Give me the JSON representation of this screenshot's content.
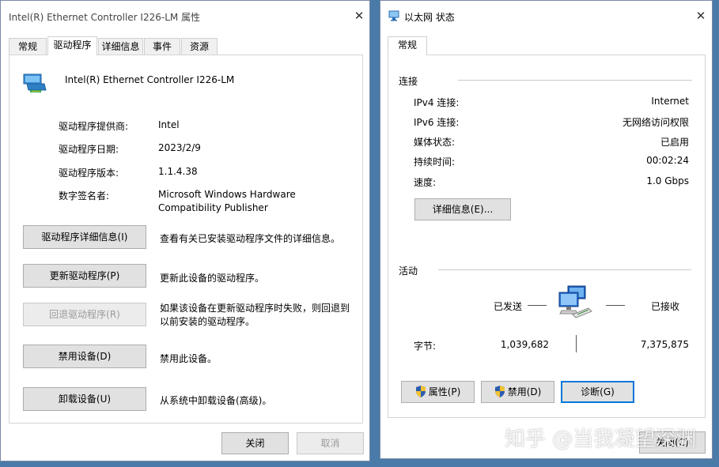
{
  "left_window": {
    "title": "Intel(R) Ethernet Controller I226-LM 属性",
    "close_glyph": "✕",
    "tabs": [
      "常规",
      "驱动程序",
      "详细信息",
      "事件",
      "资源"
    ],
    "device_name": "Intel(R) Ethernet Controller I226-LM",
    "fields": [
      {
        "label": "驱动程序提供商:",
        "value": "Intel"
      },
      {
        "label": "驱动程序日期:",
        "value": "2023/2/9"
      },
      {
        "label": "驱动程序版本:",
        "value": "1.1.4.38"
      },
      {
        "label": "数字签名者:",
        "value": "Microsoft Windows Hardware Compatibility Publisher"
      }
    ],
    "actions": [
      {
        "button": "驱动程序详细信息(I)",
        "description": "查看有关已安装驱动程序文件的详细信息。"
      },
      {
        "button": "更新驱动程序(P)",
        "description": "更新此设备的驱动程序。"
      },
      {
        "button": "回退驱动程序(R)",
        "description": "如果该设备在更新驱动程序时失败，则回退到以前安装的驱动程序。"
      },
      {
        "button": "禁用设备(D)",
        "description": "禁用此设备。"
      },
      {
        "button": "卸载设备(U)",
        "description": "从系统中卸载设备(高级)。"
      }
    ],
    "ok_label": "关闭",
    "cancel_label": "取消"
  },
  "right_window": {
    "title": "以太网 状态",
    "close_glyph": "✕",
    "tab": "常规",
    "connection": {
      "heading": "连接",
      "rows": [
        {
          "label": "IPv4 连接:",
          "value": "Internet"
        },
        {
          "label": "IPv6 连接:",
          "value": "无网络访问权限"
        },
        {
          "label": "媒体状态:",
          "value": "已启用"
        },
        {
          "label": "持续时间:",
          "value": "00:02:24"
        },
        {
          "label": "速度:",
          "value": "1.0 Gbps"
        }
      ],
      "details_button": "详细信息(E)..."
    },
    "activity": {
      "heading": "活动",
      "sent_label": "已发送",
      "received_label": "已接收",
      "bytes_label": "字节:",
      "bytes_sent": "1,039,682",
      "bytes_received": "7,375,875"
    },
    "buttons": {
      "properties": "属性(P)",
      "disable": "禁用(D)",
      "diagnose": "诊断(G)",
      "close": "关闭(C)"
    }
  },
  "watermark": "知乎 @当我凝望深渊",
  "colors": {
    "desktop": "#4a7ba8",
    "focus_border": "#0078d7",
    "disabled_text": "#9a9a9a"
  },
  "icons": {
    "device": "network-adapter-icon",
    "activity": "network-computers-icon",
    "shield": "uac-shield-icon"
  }
}
